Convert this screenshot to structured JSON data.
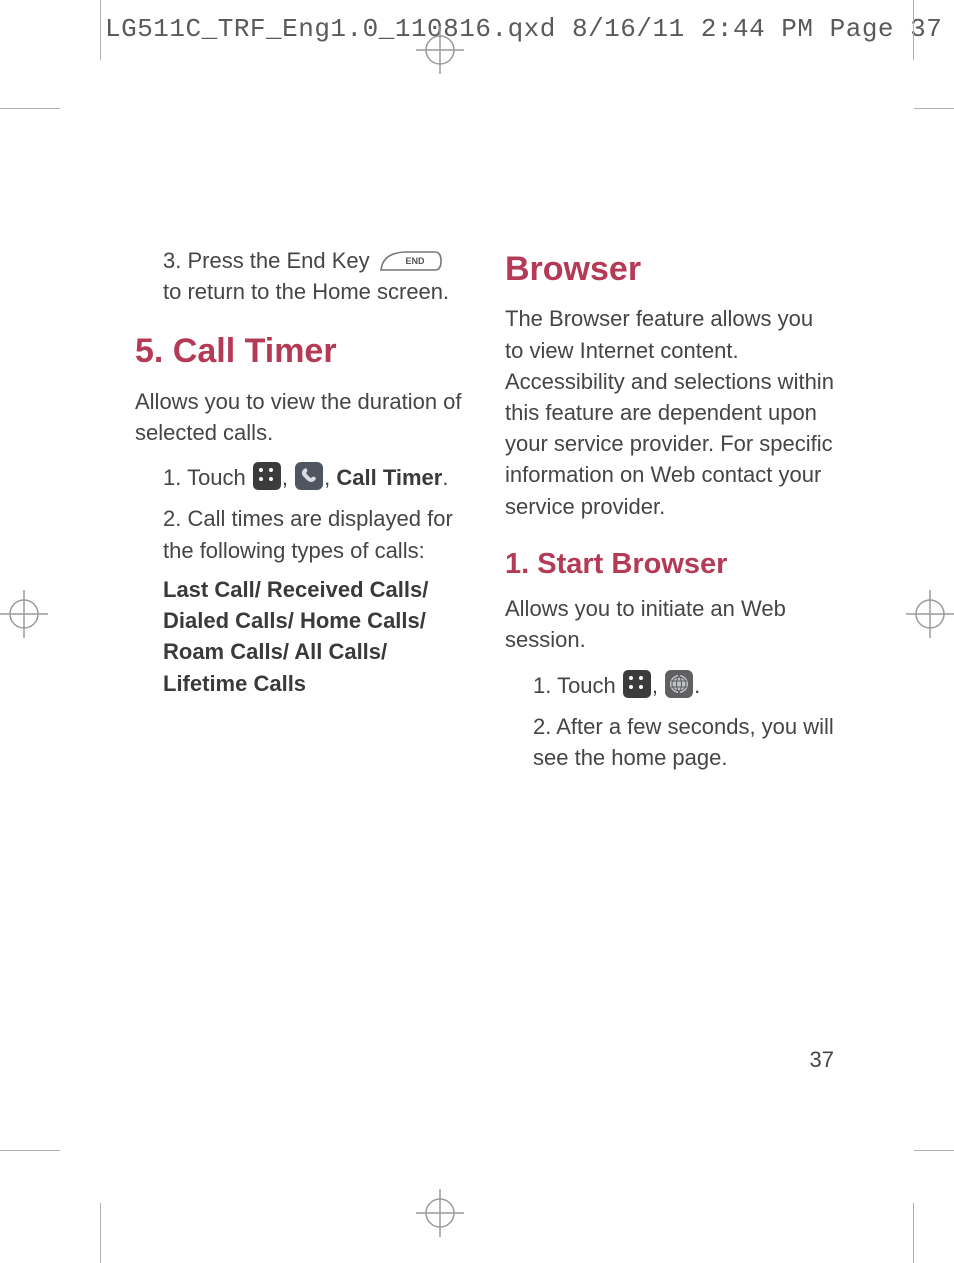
{
  "slug": "LG511C_TRF_Eng1.0_110816.qxd  8/16/11  2:44 PM  Page 37",
  "page_number": "37",
  "left": {
    "step3_a": "3. Press the End Key ",
    "step3_b": " to return to the Home screen.",
    "h1": "5. Call Timer",
    "intro": "Allows you to view the duration of selected calls.",
    "step1_a": "1. Touch ",
    "step1_comma": ", ",
    "step1_b": "Call Timer",
    "step1_period": ".",
    "step2": "2. Call times are displayed for the following types of calls:",
    "call_types": "Last Call/ Received Calls/ Dialed Calls/ Home Calls/ Roam Calls/ All Calls/ Lifetime Calls"
  },
  "right": {
    "h1": "Browser",
    "intro": "The Browser feature allows you to view Internet content. Accessibility and selections within this feature are dependent upon your service provider. For specific information on Web contact your service provider.",
    "h2": "1. Start Browser",
    "sb_intro": "Allows you to initiate an Web session.",
    "step1_a": "1. Touch ",
    "step1_comma": ", ",
    "step1_period": ".",
    "step2": "2. After a few seconds, you will see the home page."
  }
}
